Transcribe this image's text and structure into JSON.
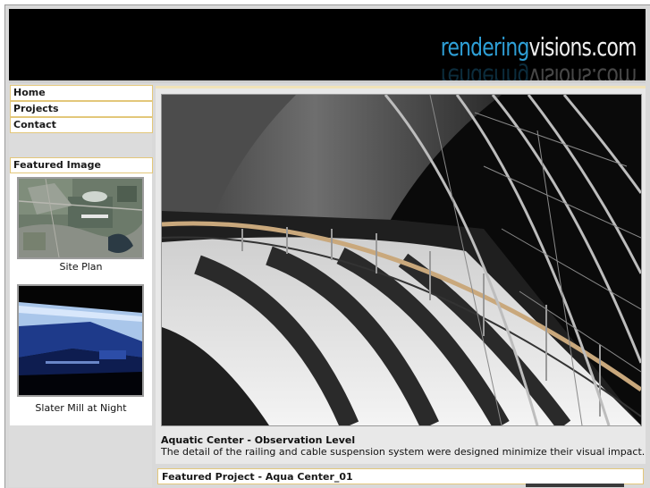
{
  "header": {
    "logo_part1": "rendering",
    "logo_part2": "visions.com",
    "accent_color": "#2e9fd6"
  },
  "nav": {
    "items": [
      {
        "label": "Home"
      },
      {
        "label": "Projects"
      },
      {
        "label": "Contact"
      }
    ]
  },
  "sidebar": {
    "featured_heading": "Featured Image",
    "thumbnails": [
      {
        "caption": "Site Plan",
        "icon": "aerial-site-plan-image"
      },
      {
        "caption": "Slater Mill at Night",
        "icon": "night-rendering-image"
      }
    ]
  },
  "main": {
    "image_icon": "aquatic-center-rendering-image",
    "caption_title": "Aquatic Center - Observation Level",
    "caption_text": "The detail of the railing and cable suspension system were designed minimize their visual impact."
  },
  "featured_project": {
    "label": "Featured Project - Aqua Center_01"
  }
}
